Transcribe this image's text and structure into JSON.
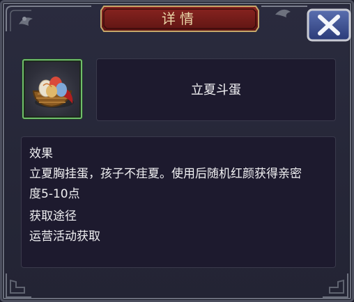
{
  "dialog": {
    "title": "详情",
    "close_symbol": "✕"
  },
  "item": {
    "name": "立夏斗蛋",
    "icon": "egg-basket-icon"
  },
  "description": {
    "effect_heading": "效果",
    "effect_line1": "立夏胸挂蛋，孩子不疰夏。使用后随机红颜获得亲密",
    "effect_line2": "度5-10点",
    "source_heading": "获取途径",
    "source_text": "运营活动获取"
  },
  "colors": {
    "title_plate": "#7a1c1a",
    "title_text": "#ead6a8",
    "slot_border": "#6fbf6a",
    "panel_bg": "#262738",
    "box_bg": "#1d1a2e"
  }
}
